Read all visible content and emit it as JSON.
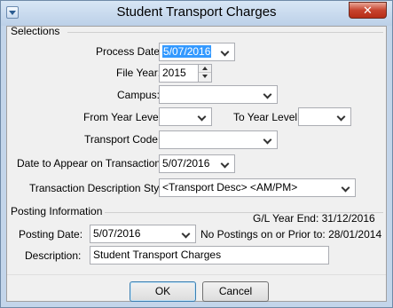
{
  "window": {
    "title": "Student Transport Charges",
    "close_glyph": "✕"
  },
  "selections": {
    "group_label": "Selections",
    "process_date": {
      "label": "Process Date:",
      "value": "5/07/2016"
    },
    "file_year": {
      "label": "File Year:",
      "value": "2015"
    },
    "campus": {
      "label": "Campus:",
      "value": ""
    },
    "from_year_level": {
      "label": "From Year Level:",
      "value": ""
    },
    "to_year_level": {
      "label": "To Year Level:",
      "value": ""
    },
    "transport_code": {
      "label": "Transport Code:",
      "value": ""
    },
    "date_on_transactions": {
      "label": "Date to Appear on Transactions:",
      "value": "5/07/2016"
    },
    "description_style": {
      "label": "Transaction Description Style:",
      "value": "<Transport Desc> <AM/PM>"
    }
  },
  "posting": {
    "group_label": "Posting Information",
    "gl_year_end": "G/L Year End:  31/12/2016",
    "posting_date": {
      "label": "Posting Date:",
      "value": "5/07/2016"
    },
    "no_postings_note": "No Postings on or Prior to: 28/01/2014",
    "description": {
      "label": "Description:",
      "value": "Student Transport Charges"
    }
  },
  "buttons": {
    "ok": "OK",
    "cancel": "Cancel"
  }
}
